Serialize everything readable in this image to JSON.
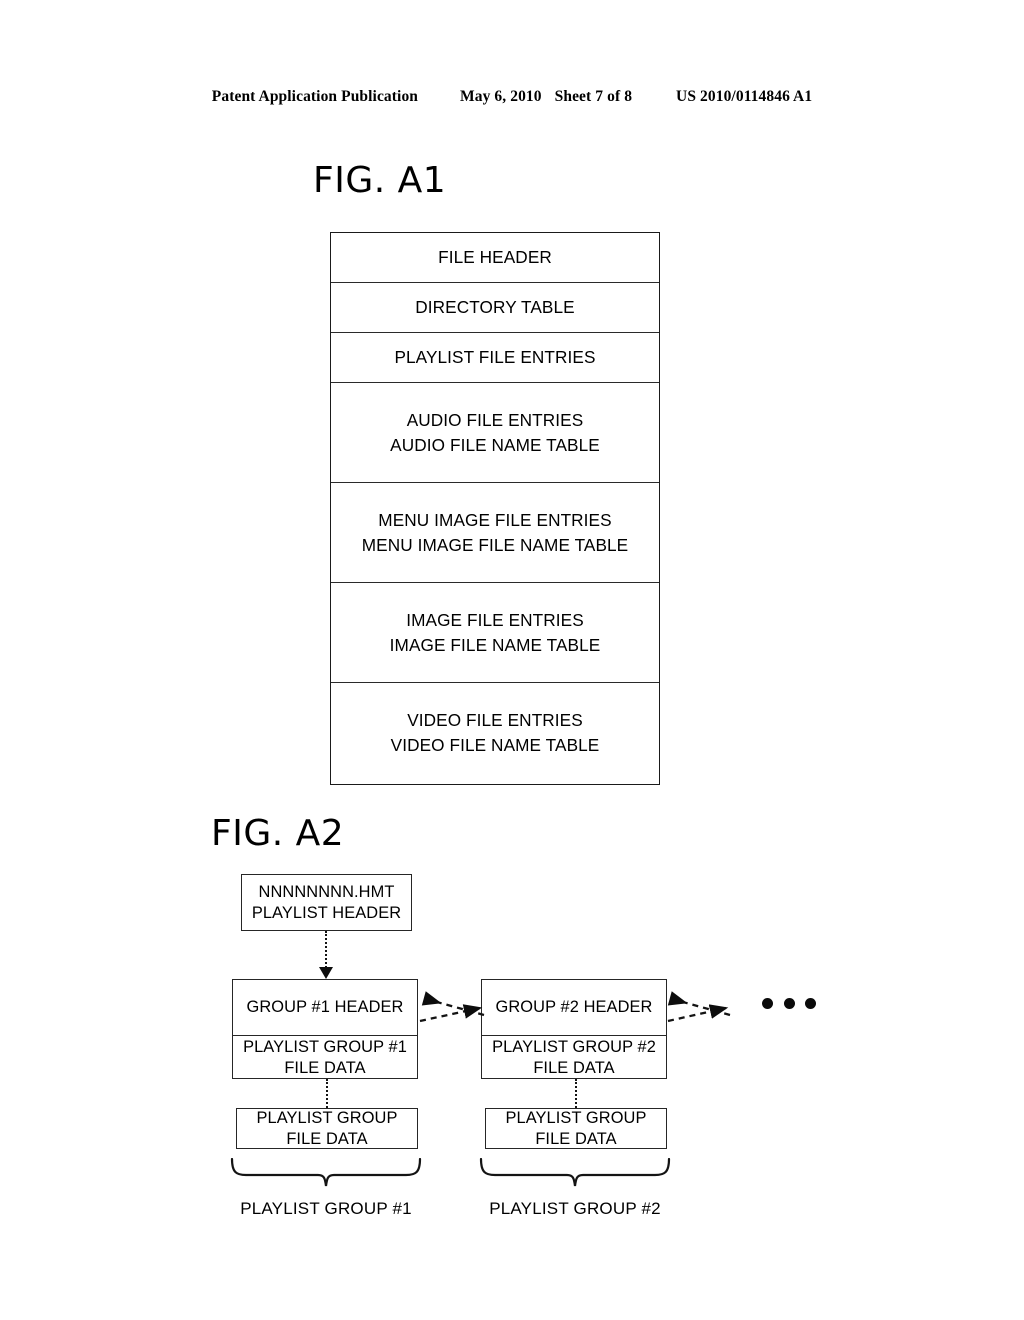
{
  "publication_header": {
    "publication_label": "Patent Application Publication",
    "date": "May 6, 2010",
    "sheet": "Sheet 7 of 8",
    "patent_number": "US 2010/0114846 A1"
  },
  "figures": {
    "fig_a1": {
      "title": "FIG. A1",
      "type": "table",
      "rows": [
        {
          "lines": [
            "FILE HEADER"
          ]
        },
        {
          "lines": [
            "DIRECTORY TABLE"
          ]
        },
        {
          "lines": [
            "PLAYLIST FILE ENTRIES"
          ]
        },
        {
          "lines": [
            "AUDIO FILE ENTRIES",
            "AUDIO FILE NAME TABLE"
          ]
        },
        {
          "lines": [
            "MENU IMAGE FILE ENTRIES",
            "MENU IMAGE FILE NAME TABLE"
          ]
        },
        {
          "lines": [
            "IMAGE FILE ENTRIES",
            "IMAGE FILE NAME TABLE"
          ]
        },
        {
          "lines": [
            "VIDEO FILE ENTRIES",
            "VIDEO FILE NAME TABLE"
          ]
        }
      ]
    },
    "fig_a2": {
      "title": "FIG. A2",
      "playlist_header_box": {
        "line1": "NNNNNNNN.HMT",
        "line2": "PLAYLIST HEADER"
      },
      "group1": {
        "header": "GROUP #1 HEADER",
        "data_line1": "PLAYLIST GROUP #1",
        "data_line2": "FILE DATA"
      },
      "group2": {
        "header": "GROUP #2 HEADER",
        "data_line1": "PLAYLIST GROUP #2",
        "data_line2": "FILE DATA"
      },
      "extra_data_box1": {
        "line1": "PLAYLIST GROUP",
        "line2": "FILE DATA"
      },
      "extra_data_box2": {
        "line1": "PLAYLIST GROUP",
        "line2": "FILE DATA"
      },
      "brace_caption1": "PLAYLIST GROUP #1",
      "brace_caption2": "PLAYLIST GROUP #2",
      "continuation": "• • •"
    }
  },
  "colors": {
    "ink": "#000000",
    "background": "#ffffff",
    "line": "#262626"
  }
}
